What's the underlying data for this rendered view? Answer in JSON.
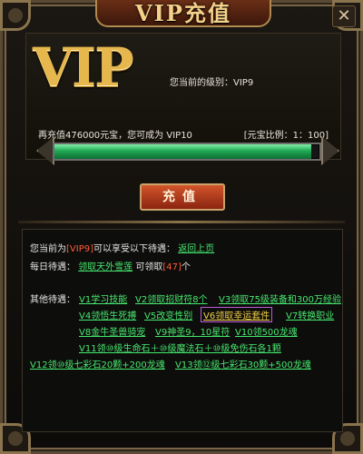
{
  "window": {
    "title": "VIP充值",
    "close_glyph": "✕"
  },
  "status": {
    "vip_logo": "VIP",
    "level_label": "您当前的级别：",
    "level_value": "VIP9",
    "recharge_prefix": "再充值",
    "recharge_amount": "476000",
    "recharge_suffix": "元宝，您可成为",
    "next_level": "VIP10",
    "ratio": "[元宝比例：1：100]",
    "progress_fraction": 0.97,
    "progress_color": "#20a855"
  },
  "recharge_button": {
    "label": "充值"
  },
  "info": {
    "current_prefix": "您当前为",
    "current_level": "[VIP9]",
    "current_suffix": "可以享受以下待遇：",
    "back_link": "返回上页",
    "daily_label": "每日待遇：",
    "daily_link": "领取天外雪莲",
    "daily_count_prefix": "可领取",
    "daily_count": "[47]",
    "daily_count_suffix": "个",
    "other_label": "其他待遇：",
    "perks": [
      "V1学习技能",
      "V2领取招财符8个",
      "V3领取75级装备和300万经验",
      "V4领悟生死搏",
      "V5改变性别",
      "V6领取幸运套件",
      "V7转换职业",
      "V8金牛圣兽骑宠",
      "V9神圣9，10星符",
      "V10领500龙魂",
      "V11领⑩级生命石＋⑩级魔法石＋⑩级免伤石各1颗",
      "V12领⑩级七彩石20颗+200龙魂",
      "V13领⑫级七彩石30颗+500龙魂"
    ],
    "highlighted_perk_index": 5
  }
}
